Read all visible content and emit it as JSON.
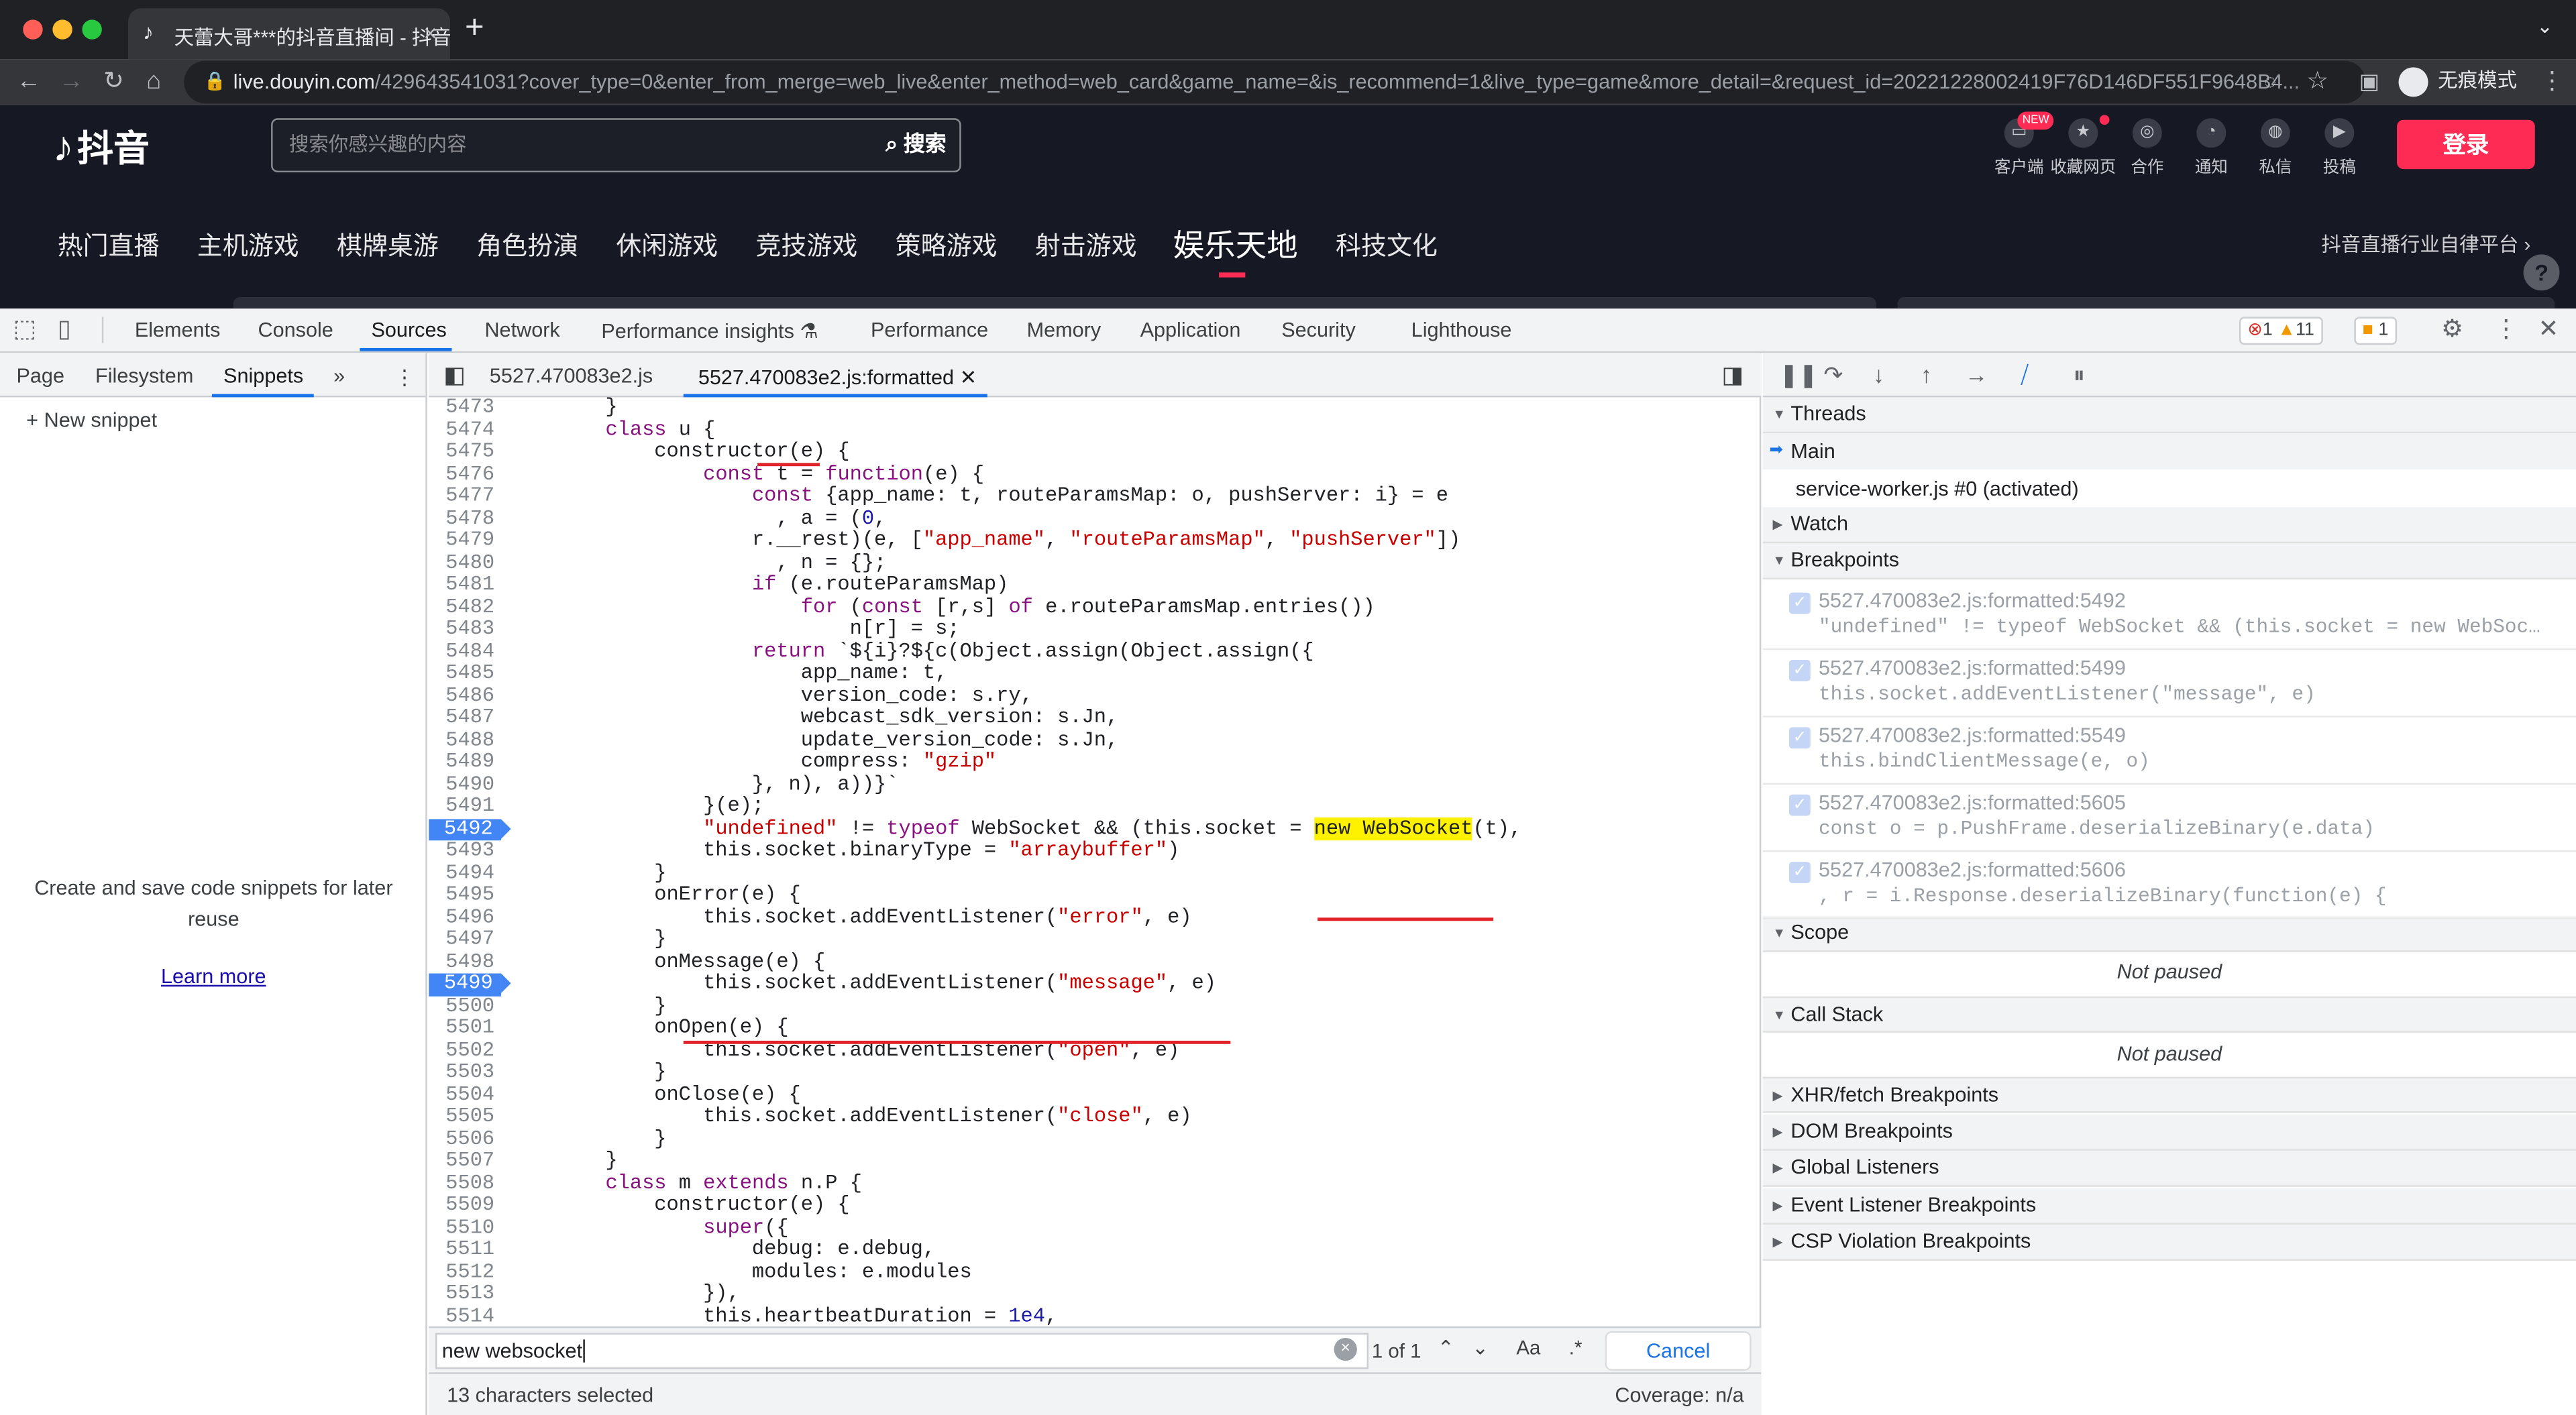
{
  "browser": {
    "tab_title": "天蕾大哥***的抖音直播间 - 抖音直",
    "url_host": "live.douyin.com",
    "url_rest": "/429643541031?cover_type=0&enter_from_merge=web_live&enter_method=web_card&game_name=&is_recommend=1&live_type=game&more_detail=&request_id=20221228002419F76D146DF551F9648B4...",
    "incognito_label": "无痕模式"
  },
  "site": {
    "logo_text": "抖音",
    "search_placeholder": "搜索你感兴趣的内容",
    "search_button": "搜索",
    "header_icons": [
      {
        "label": "客户端",
        "icon": "client-icon"
      },
      {
        "label": "收藏网页",
        "icon": "star-icon"
      },
      {
        "label": "合作",
        "icon": "handshake-icon"
      },
      {
        "label": "通知",
        "icon": "bell-icon"
      },
      {
        "label": "私信",
        "icon": "message-icon"
      },
      {
        "label": "投稿",
        "icon": "upload-icon"
      }
    ],
    "new_badge": "NEW",
    "login_button": "登录",
    "nav": [
      "热门直播",
      "主机游戏",
      "棋牌桌游",
      "角色扮演",
      "休闲游戏",
      "竞技游戏",
      "策略游戏",
      "射击游戏",
      "娱乐天地",
      "科技文化"
    ],
    "nav_active": "娱乐天地",
    "platform_link": "抖音直播行业自律平台",
    "help_button": "?"
  },
  "devtools": {
    "tabs": [
      "Elements",
      "Console",
      "Sources",
      "Network",
      "Performance insights",
      "Performance",
      "Memory",
      "Application",
      "Security",
      "Lighthouse"
    ],
    "active_tab": "Sources",
    "errors": "1",
    "warnings": "11",
    "issues": "1",
    "navigator": {
      "tabs": [
        "Page",
        "Filesystem",
        "Snippets"
      ],
      "active": "Snippets",
      "new_snippet": "New snippet",
      "empty_text": "Create and save code snippets for later reuse",
      "learn_more": "Learn more"
    },
    "editor": {
      "tabs": [
        "5527.470083e2.js",
        "5527.470083e2.js:formatted"
      ],
      "active_tab": "5527.470083e2.js:formatted",
      "lines": [
        {
          "n": "5473",
          "t": "        }"
        },
        {
          "n": "5474",
          "t": "        class u {"
        },
        {
          "n": "5475",
          "t": "            constructor(e) {"
        },
        {
          "n": "5476",
          "t": "                const t = function(e) {"
        },
        {
          "n": "5477",
          "t": "                    const {app_name: t, routeParamsMap: o, pushServer: i} = e"
        },
        {
          "n": "5478",
          "t": "                      , a = (0,"
        },
        {
          "n": "5479",
          "t": "                    r.__rest)(e, [\"app_name\", \"routeParamsMap\", \"pushServer\"])"
        },
        {
          "n": "5480",
          "t": "                      , n = {};"
        },
        {
          "n": "5481",
          "t": "                    if (e.routeParamsMap)"
        },
        {
          "n": "5482",
          "t": "                        for (const [r,s] of e.routeParamsMap.entries())"
        },
        {
          "n": "5483",
          "t": "                            n[r] = s;"
        },
        {
          "n": "5484",
          "t": "                    return `${i}?${c(Object.assign(Object.assign({"
        },
        {
          "n": "5485",
          "t": "                        app_name: t,"
        },
        {
          "n": "5486",
          "t": "                        version_code: s.ry,"
        },
        {
          "n": "5487",
          "t": "                        webcast_sdk_version: s.Jn,"
        },
        {
          "n": "5488",
          "t": "                        update_version_code: s.Jn,"
        },
        {
          "n": "5489",
          "t": "                        compress: \"gzip\""
        },
        {
          "n": "5490",
          "t": "                    }, n), a))}`"
        },
        {
          "n": "5491",
          "t": "                }(e);"
        },
        {
          "n": "5492",
          "t": "                \"undefined\" != typeof WebSocket && (this.socket = new WebSocket(t),",
          "bp": true
        },
        {
          "n": "5493",
          "t": "                this.socket.binaryType = \"arraybuffer\")"
        },
        {
          "n": "5494",
          "t": "            }"
        },
        {
          "n": "5495",
          "t": "            onError(e) {"
        },
        {
          "n": "5496",
          "t": "                this.socket.addEventListener(\"error\", e)"
        },
        {
          "n": "5497",
          "t": "            }"
        },
        {
          "n": "5498",
          "t": "            onMessage(e) {"
        },
        {
          "n": "5499",
          "t": "                this.socket.addEventListener(\"message\", e)",
          "bp": true
        },
        {
          "n": "5500",
          "t": "            }"
        },
        {
          "n": "5501",
          "t": "            onOpen(e) {"
        },
        {
          "n": "5502",
          "t": "                this.socket.addEventListener(\"open\", e)"
        },
        {
          "n": "5503",
          "t": "            }"
        },
        {
          "n": "5504",
          "t": "            onClose(e) {"
        },
        {
          "n": "5505",
          "t": "                this.socket.addEventListener(\"close\", e)"
        },
        {
          "n": "5506",
          "t": "            }"
        },
        {
          "n": "5507",
          "t": "        }"
        },
        {
          "n": "5508",
          "t": "        class m extends n.P {"
        },
        {
          "n": "5509",
          "t": "            constructor(e) {"
        },
        {
          "n": "5510",
          "t": "                super({"
        },
        {
          "n": "5511",
          "t": "                    debug: e.debug,"
        },
        {
          "n": "5512",
          "t": "                    modules: e.modules"
        },
        {
          "n": "5513",
          "t": "                }),"
        },
        {
          "n": "5514",
          "t": "                this.heartbeatDuration = 1e4,"
        }
      ],
      "highlight_text": "new WebSocket",
      "find_query": "new websocket",
      "find_count": "1 of 1",
      "find_case": "Aa",
      "find_regex": ".*",
      "find_cancel": "Cancel",
      "status_selection": "13 characters selected",
      "status_coverage": "Coverage: n/a"
    },
    "debugger": {
      "sections": {
        "threads": "Threads",
        "watch": "Watch",
        "breakpoints": "Breakpoints",
        "scope": "Scope",
        "call_stack": "Call Stack",
        "xhr": "XHR/fetch Breakpoints",
        "dom": "DOM Breakpoints",
        "global": "Global Listeners",
        "event": "Event Listener Breakpoints",
        "csp": "CSP Violation Breakpoints"
      },
      "threads": [
        "Main",
        "service-worker.js #0 (activated)"
      ],
      "breakpoints": [
        {
          "loc": "5527.470083e2.js:formatted:5492",
          "code": "\"undefined\" != typeof WebSocket && (this.socket = new WebSoc…"
        },
        {
          "loc": "5527.470083e2.js:formatted:5499",
          "code": "this.socket.addEventListener(\"message\", e)"
        },
        {
          "loc": "5527.470083e2.js:formatted:5549",
          "code": "this.bindClientMessage(e, o)"
        },
        {
          "loc": "5527.470083e2.js:formatted:5605",
          "code": "const o = p.PushFrame.deserializeBinary(e.data)"
        },
        {
          "loc": "5527.470083e2.js:formatted:5606",
          "code": ", r = i.Response.deserializeBinary(function(e) {"
        }
      ],
      "not_paused": "Not paused"
    }
  }
}
